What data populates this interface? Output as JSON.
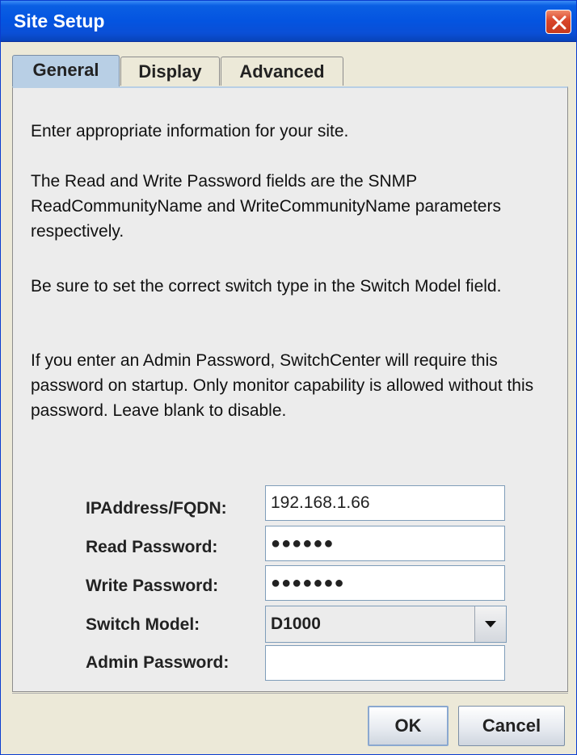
{
  "window": {
    "title": "Site Setup"
  },
  "tabs": [
    {
      "label": "General",
      "active": true
    },
    {
      "label": "Display",
      "active": false
    },
    {
      "label": "Advanced",
      "active": false
    }
  ],
  "instructions": {
    "p1": "Enter appropriate information for your site.",
    "p2": "The Read and Write Password fields are the SNMP ReadCommunityName and WriteCommunityName parameters respectively.",
    "p3": "Be sure to set the correct switch type in the Switch Model field.",
    "p4": "If you enter an Admin Password, SwitchCenter will require this password on startup. Only monitor capability is allowed without this password. Leave blank to disable."
  },
  "form": {
    "ip_label": "IPAddress/FQDN:",
    "ip_value": "192.168.1.66",
    "read_label": "Read Password:",
    "read_value": "●●●●●●",
    "write_label": "Write Password:",
    "write_value": "●●●●●●●",
    "model_label": "Switch Model:",
    "model_value": "D1000",
    "admin_label": "Admin Password:",
    "admin_value": ""
  },
  "buttons": {
    "ok": "OK",
    "cancel": "Cancel"
  },
  "icons": {
    "close": "close-icon",
    "dropdown": "chevron-down-icon"
  },
  "colors": {
    "titlebar": "#0454e0",
    "active_tab": "#b8cfe5",
    "close": "#d8452a"
  }
}
